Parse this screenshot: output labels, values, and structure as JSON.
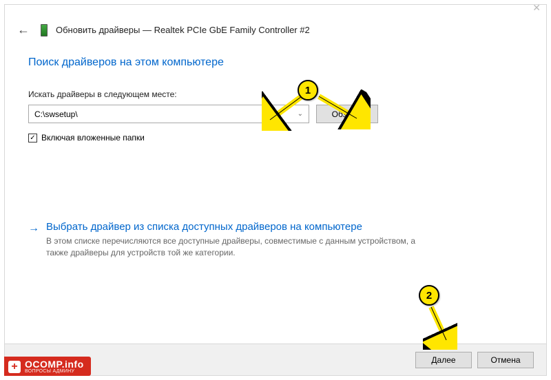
{
  "header": {
    "title": "Обновить драйверы — Realtek PCIe GbE Family Controller #2"
  },
  "page": {
    "heading": "Поиск драйверов на этом компьютере",
    "path_label": "Искать драйверы в следующем месте:",
    "path_value": "C:\\swsetup\\",
    "browse_label": "Обзор...",
    "include_subfolders_label": "Включая вложенные папки"
  },
  "link_section": {
    "title": "Выбрать драйвер из списка доступных драйверов на компьютере",
    "description": "В этом списке перечисляются все доступные драйверы, совместимые с данным устройством, а также драйверы для устройств той же категории."
  },
  "footer": {
    "next_label": "Далее",
    "cancel_label": "Отмена"
  },
  "annotations": {
    "badge1": "1",
    "badge2": "2"
  },
  "watermark": {
    "main": "OCOMP.info",
    "sub": "ВОПРОСЫ АДМИНУ"
  }
}
